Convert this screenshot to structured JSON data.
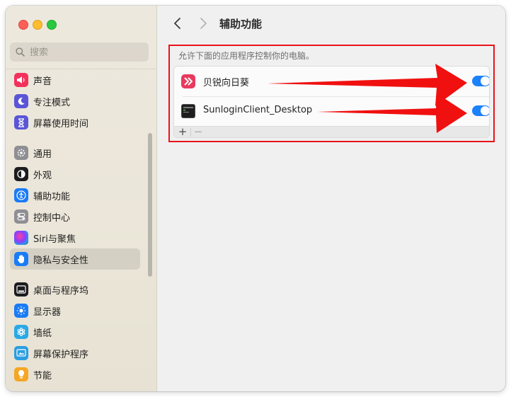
{
  "window": {
    "title": "辅助功能"
  },
  "search": {
    "placeholder": "搜索"
  },
  "sidebar": {
    "items": [
      {
        "label": "声音",
        "icon": "speaker-icon",
        "color": "#f2325a"
      },
      {
        "label": "专注模式",
        "icon": "moon-icon",
        "color": "#5a56d6"
      },
      {
        "label": "屏幕使用时间",
        "icon": "hourglass-icon",
        "color": "#5a56d6"
      },
      {
        "label": "通用",
        "icon": "gear-icon",
        "color": "#8e8e93"
      },
      {
        "label": "外观",
        "icon": "appearance-icon",
        "color": "#1c1c1e"
      },
      {
        "label": "辅助功能",
        "icon": "accessibility-icon",
        "color": "#1a7cf5"
      },
      {
        "label": "控制中心",
        "icon": "control-center-icon",
        "color": "#8e8e93"
      },
      {
        "label": "Siri与聚焦",
        "icon": "siri-icon",
        "color": "#222222"
      },
      {
        "label": "隐私与安全性",
        "icon": "hand-icon",
        "color": "#1a7cf5",
        "selected": true
      },
      {
        "label": "桌面与程序坞",
        "icon": "dock-icon",
        "color": "#1c1c1e"
      },
      {
        "label": "显示器",
        "icon": "sun-icon",
        "color": "#1a7cf5"
      },
      {
        "label": "墙纸",
        "icon": "wallpaper-icon",
        "color": "#29a9e6"
      },
      {
        "label": "屏幕保护程序",
        "icon": "screensaver-icon",
        "color": "#2b9de0"
      },
      {
        "label": "节能",
        "icon": "lightbulb-icon",
        "color": "#f5a623"
      }
    ]
  },
  "main": {
    "description": "允许下面的应用程序控制你的电脑。",
    "apps": [
      {
        "name": "贝锐向日葵",
        "icon": "sunflower-app-icon",
        "enabled": true
      },
      {
        "name": "SunloginClient_Desktop",
        "icon": "terminal-app-icon",
        "enabled": true
      }
    ],
    "footer": {
      "add": "+",
      "remove": "−"
    }
  },
  "colors": {
    "accent": "#1a82fb",
    "annotation": "#e8141a"
  }
}
